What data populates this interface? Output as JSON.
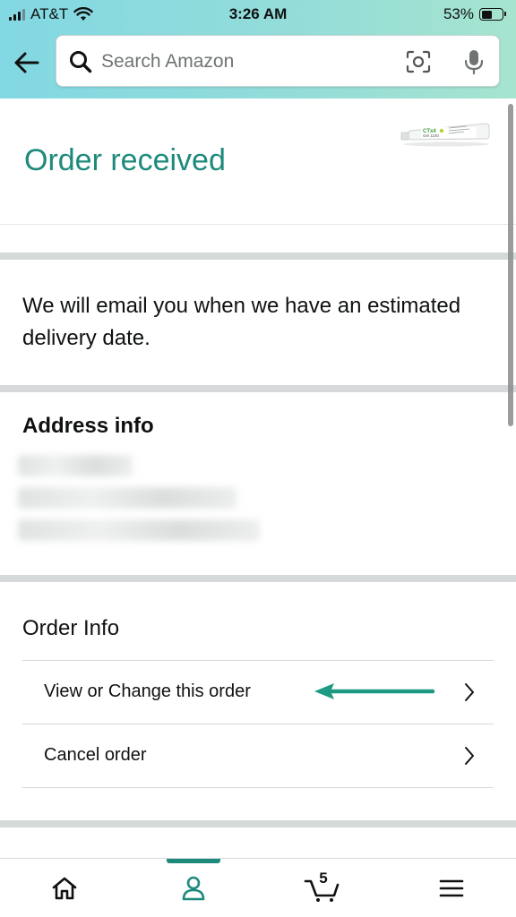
{
  "status_bar": {
    "carrier": "AT&T",
    "time": "3:26 AM",
    "battery_percent": "53%",
    "battery_level": 0.53
  },
  "header": {
    "back_icon": "arrow-left-icon",
    "search": {
      "placeholder": "Search Amazon",
      "icons": [
        "search-icon",
        "camera-scan-icon",
        "microphone-icon"
      ]
    }
  },
  "order": {
    "title": "Order received",
    "product_label": "CTx4 Gel 1100",
    "delivery_message": "We will email you when we have an estimated delivery date."
  },
  "address": {
    "heading": "Address info",
    "lines_redacted": 3
  },
  "order_info": {
    "heading": "Order Info",
    "rows": [
      {
        "label": "View or Change this order",
        "icon": "chevron-right-icon"
      },
      {
        "label": "Cancel order",
        "icon": "chevron-right-icon"
      }
    ]
  },
  "bottom_nav": {
    "items": [
      "home-icon",
      "account-icon",
      "cart-icon",
      "menu-icon"
    ],
    "active": "account-icon",
    "cart_count": "5"
  },
  "colors": {
    "accent": "#1d8a7c",
    "header_gradient_start": "#82d8e3",
    "header_gradient_end": "#a6e4cf",
    "text": "#0f1111"
  }
}
